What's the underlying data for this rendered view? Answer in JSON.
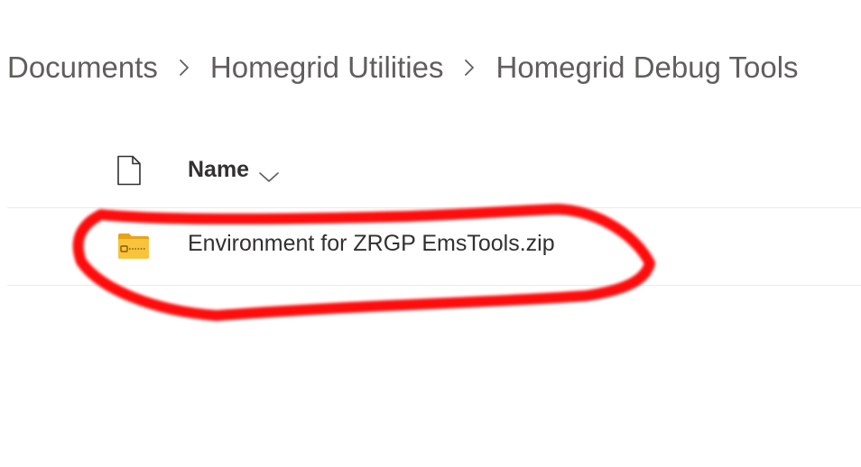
{
  "breadcrumb": {
    "items": [
      {
        "label": "Documents"
      },
      {
        "label": "Homegrid Utilities"
      },
      {
        "label": "Homegrid Debug Tools"
      }
    ],
    "separator_icon": "chevron-right-icon"
  },
  "list": {
    "header": {
      "file_type_icon": "document-icon",
      "name_label": "Name",
      "sort_icon": "chevron-down-icon"
    },
    "rows": [
      {
        "icon": "zip-folder-icon",
        "name": "Environment for ZRGP EmsTools.zip"
      }
    ]
  },
  "annotation": {
    "type": "hand-drawn-circle",
    "color": "#ff0000"
  },
  "colors": {
    "breadcrumb_text": "#605e5c",
    "text": "#323130",
    "divider": "#edebe9",
    "folder_yellow": "#f8c43b",
    "folder_dark": "#e8a317"
  }
}
